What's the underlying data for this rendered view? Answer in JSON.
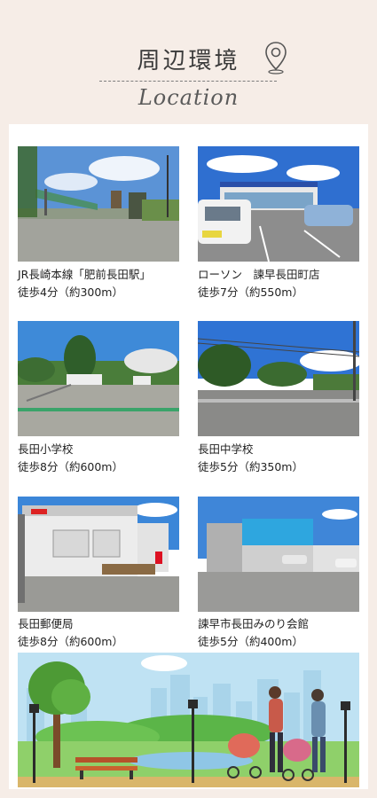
{
  "header": {
    "title": "周辺環境",
    "subtitle": "Location",
    "icon": "map-pin-icon"
  },
  "places": [
    {
      "name": "JR長崎本線「肥前長田駅」",
      "distance": "徒歩4分（約300m）"
    },
    {
      "name": "ローソン　諫早長田町店",
      "distance": "徒歩7分（約550m）"
    },
    {
      "name": "長田小学校",
      "distance": "徒歩8分（約600m）"
    },
    {
      "name": "長田中学校",
      "distance": "徒歩5分（約350m）"
    },
    {
      "name": "長田郵便局",
      "distance": "徒歩8分（約600m）"
    },
    {
      "name": "諫早市長田みのり会館",
      "distance": "徒歩5分（約400m）"
    }
  ],
  "colors": {
    "background": "#f6ede7",
    "card": "#ffffff",
    "text": "#222222"
  }
}
